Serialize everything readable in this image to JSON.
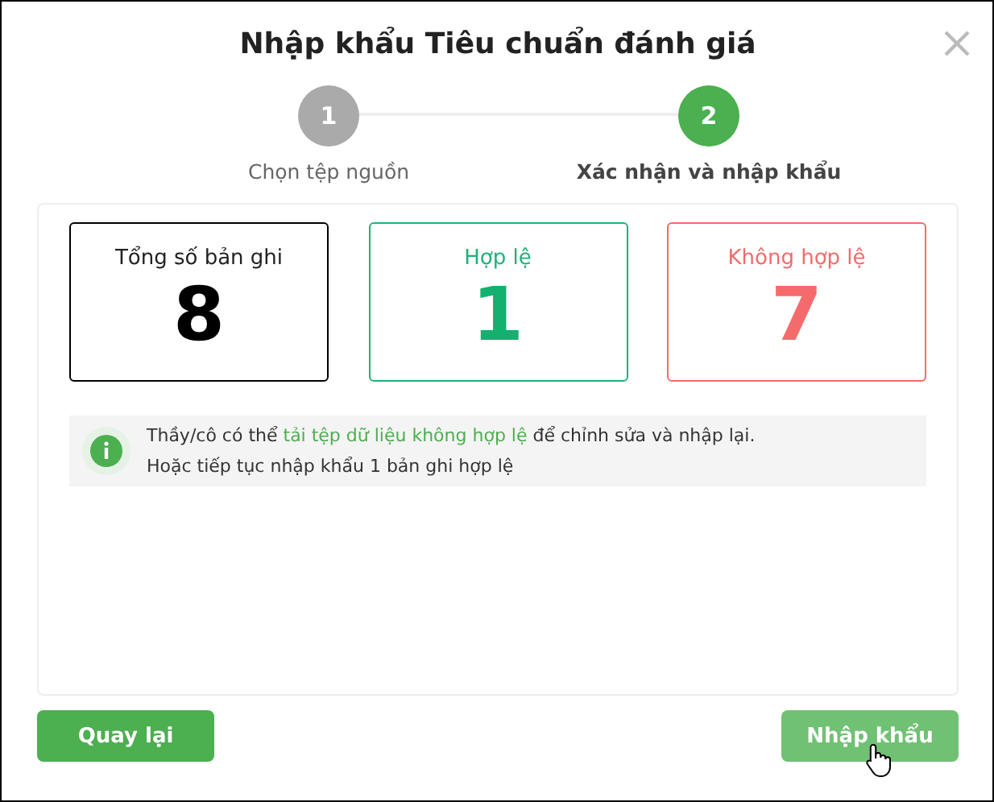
{
  "title": "Nhập khẩu Tiêu chuẩn đánh giá",
  "steps": [
    {
      "number": "1",
      "label": "Chọn tệp nguồn",
      "selected": false
    },
    {
      "number": "2",
      "label": "Xác nhận và nhập khẩu",
      "selected": true
    }
  ],
  "stats": [
    {
      "kind": "total",
      "label": "Tổng số bản ghi",
      "value": "8"
    },
    {
      "kind": "valid",
      "label": "Hợp lệ",
      "value": "1"
    },
    {
      "kind": "invalid",
      "label": "Không hợp lệ",
      "value": "7"
    }
  ],
  "info": {
    "before_link": "Thầy/cô có thể ",
    "link": "tải tệp dữ liệu không hợp lệ",
    "after_link": " để chỉnh sửa và nhập lại.",
    "line_2": "Hoặc tiếp tục nhập khẩu 1 bản ghi hợp lệ"
  },
  "buttons": [
    {
      "label": "Quay lại",
      "hovered": false
    },
    {
      "label": "Nhập khẩu",
      "hovered": true
    }
  ]
}
